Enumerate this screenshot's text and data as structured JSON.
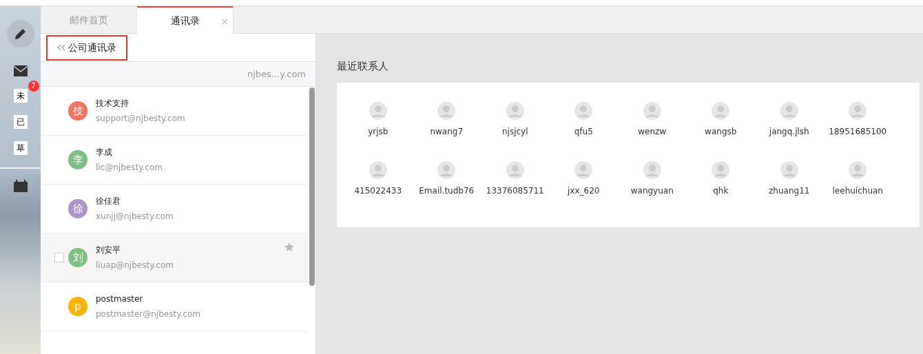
{
  "sidebar": {
    "folders": [
      {
        "label": "未",
        "badge": "7"
      },
      {
        "label": "已"
      },
      {
        "label": "草"
      }
    ]
  },
  "tabs": [
    {
      "label": "邮件首页",
      "selected": false
    },
    {
      "label": "通讯录",
      "selected": true,
      "close_symbol": "×"
    }
  ],
  "directory": {
    "title": "公司通讯录",
    "highlighted": true,
    "domain": "njbes...y.com",
    "contacts": [
      {
        "initial": "技",
        "name": "技术支持",
        "email": "support@njbesty.com",
        "color": "#f5735e",
        "selected": false
      },
      {
        "initial": "李",
        "name": "李成",
        "email": "lic@njbesty.com",
        "color": "#7fc087",
        "selected": false
      },
      {
        "initial": "徐",
        "name": "徐佳君",
        "email": "xunjj@njbesty.com",
        "color": "#ae97c6",
        "selected": false
      },
      {
        "initial": "刘",
        "name": "刘安平",
        "email": "liuap@njbesty.com",
        "color": "#7fc087",
        "selected": true
      },
      {
        "initial": "p",
        "name": "postmaster",
        "email": "postmaster@njbesty.com",
        "color": "#fbb301",
        "selected": false
      }
    ]
  },
  "recent": {
    "title": "最近联系人",
    "contacts": [
      "yrjsb",
      "nwang7",
      "njsjcyl",
      "qfu5",
      "wenzw",
      "wangsb",
      "jangq.jlsh",
      "18951685100",
      "415022433",
      "Email.tudb76",
      "13376085711",
      "jxx_620",
      "wangyuan",
      "qhk",
      "zhuang11",
      "leehuichuan"
    ]
  }
}
